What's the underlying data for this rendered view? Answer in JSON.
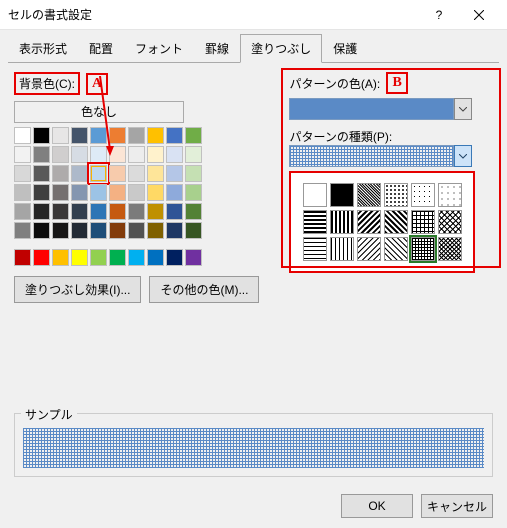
{
  "title": "セルの書式設定",
  "tabs": [
    "表示形式",
    "配置",
    "フォント",
    "罫線",
    "塗りつぶし",
    "保護"
  ],
  "active_tab": "塗りつぶし",
  "bg_label": "背景色(C):",
  "callout_a": "A",
  "callout_b": "B",
  "no_color": "色なし",
  "effects_btn": "塗りつぶし効果(I)...",
  "other_btn": "その他の色(M)...",
  "pattern_color_label": "パターンの色(A):",
  "pattern_type_label": "パターンの種類(P):",
  "sample_label": "サンプル",
  "ok": "OK",
  "cancel": "キャンセル",
  "swatch_colors": {
    "row1": [
      "#ffffff",
      "#000000",
      "#e7e6e6",
      "#44546a",
      "#5b9bd5",
      "#ed7d31",
      "#a5a5a5",
      "#ffc000",
      "#4472c4",
      "#70ad47"
    ],
    "row2": [
      "#f2f2f2",
      "#808080",
      "#d0cece",
      "#d6dce4",
      "#deebf6",
      "#fbe5d5",
      "#ededed",
      "#fff2cc",
      "#d9e2f3",
      "#e2efd9"
    ],
    "row3": [
      "#d8d8d8",
      "#595959",
      "#aeabab",
      "#adb9ca",
      "#bdd7ee",
      "#f7cbac",
      "#dbdbdb",
      "#fee599",
      "#b4c6e7",
      "#c5e0b3"
    ],
    "row4": [
      "#bfbfbf",
      "#3f3f3f",
      "#757070",
      "#8496b0",
      "#9cc3e5",
      "#f4b183",
      "#c9c9c9",
      "#ffd965",
      "#8eaadb",
      "#a8d08d"
    ],
    "row5": [
      "#a5a5a5",
      "#262626",
      "#3a3838",
      "#323f4f",
      "#2e75b5",
      "#c55a11",
      "#7b7b7b",
      "#bf9000",
      "#2f5496",
      "#538135"
    ],
    "row6": [
      "#7f7f7f",
      "#0c0c0c",
      "#171616",
      "#222a35",
      "#1e4e79",
      "#833c0b",
      "#525252",
      "#7f6000",
      "#1f3864",
      "#375623"
    ],
    "std": [
      "#c00000",
      "#ff0000",
      "#ffc000",
      "#ffff00",
      "#92d050",
      "#00b050",
      "#00b0f0",
      "#0070c0",
      "#002060",
      "#7030a0"
    ]
  }
}
